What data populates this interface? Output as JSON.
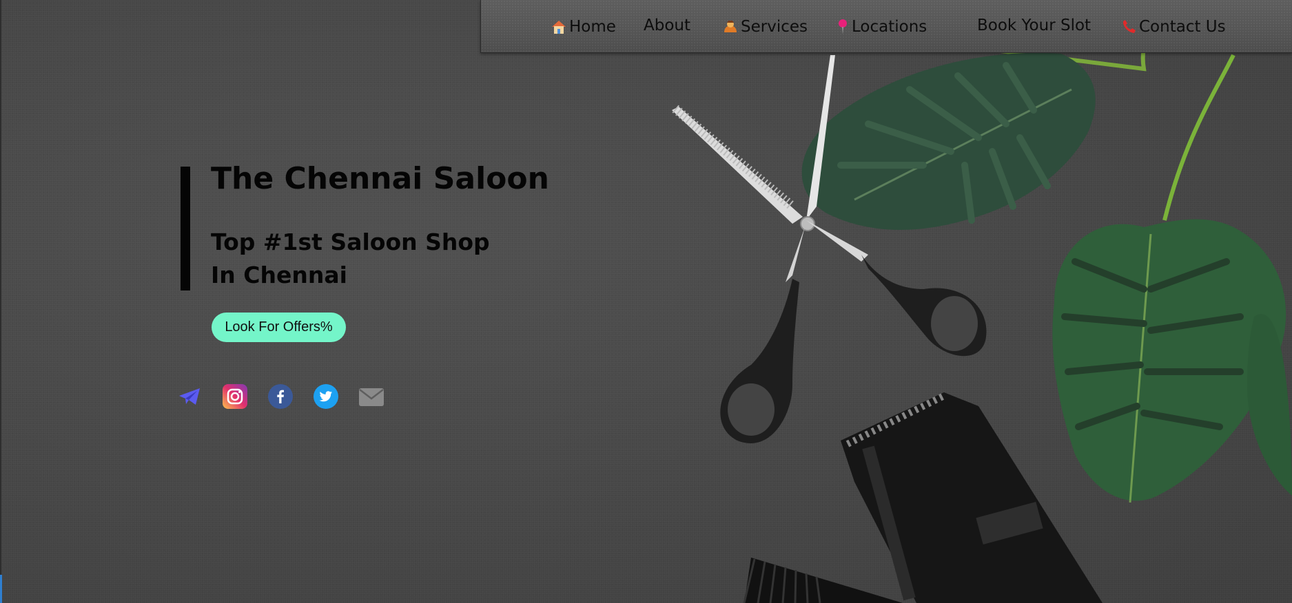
{
  "nav": {
    "items": [
      {
        "label": "Home",
        "icon": "home-icon"
      },
      {
        "label": "About",
        "icon": ""
      },
      {
        "label": "Services",
        "icon": "barber-icon"
      },
      {
        "label": "Locations",
        "icon": "pushpin-icon"
      },
      {
        "label": "Book Your Slot",
        "icon": ""
      },
      {
        "label": "Contact Us",
        "icon": "phone-icon"
      }
    ]
  },
  "hero": {
    "title": "The Chennai Saloon",
    "subtitle_line1": "Top #1st Saloon Shop",
    "subtitle_line2": "In Chennai",
    "offers_button": "Look For Offers%"
  },
  "social": [
    {
      "name": "telegram-icon",
      "color": "#5b5bf0"
    },
    {
      "name": "instagram-icon",
      "color": "#e1306c"
    },
    {
      "name": "facebook-icon",
      "color": "#3b5998"
    },
    {
      "name": "twitter-icon",
      "color": "#1da1f2"
    },
    {
      "name": "mail-icon",
      "color": "#8a8a8a"
    }
  ],
  "colors": {
    "background": "#474747",
    "button_accent": "#74f5c9",
    "text": "#050505"
  }
}
